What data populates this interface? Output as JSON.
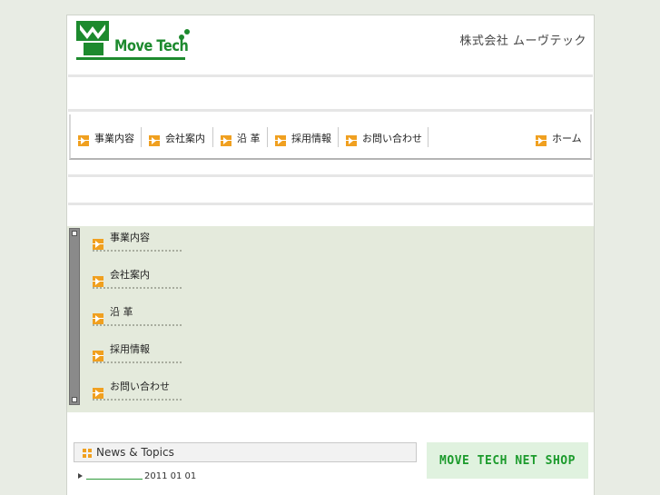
{
  "header": {
    "logo_text": "Move Tech",
    "company_name": "株式会社 ムーヴテック"
  },
  "nav": {
    "items": [
      {
        "label": "事業内容"
      },
      {
        "label": "会社案内"
      },
      {
        "label": "沿 革"
      },
      {
        "label": "採用情報"
      },
      {
        "label": "お問い合わせ"
      }
    ],
    "home_label": "ホーム"
  },
  "submenu": {
    "items": [
      {
        "label": "事業内容"
      },
      {
        "label": "会社案内"
      },
      {
        "label": "沿 革"
      },
      {
        "label": "採用情報"
      },
      {
        "label": "お問い合わせ"
      }
    ]
  },
  "news": {
    "title": "News & Topics",
    "items": [
      {
        "date": "2011 01 01"
      }
    ]
  },
  "shop": {
    "label": "MOVE TECH NET SHOP"
  },
  "colors": {
    "brand_green": "#1d8a2e",
    "accent_orange": "#f0a020",
    "background": "#e8ece4",
    "panel": "#e4eadc"
  }
}
